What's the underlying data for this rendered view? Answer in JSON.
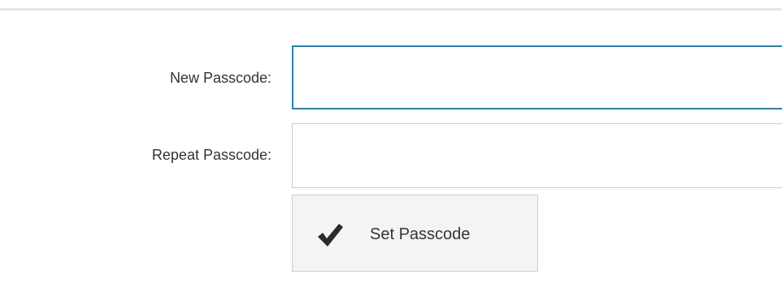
{
  "form": {
    "new_passcode_label": "New Passcode:",
    "new_passcode_value": "",
    "repeat_passcode_label": "Repeat Passcode:",
    "repeat_passcode_value": "",
    "submit_label": "Set Passcode",
    "submit_icon": "checkmark-icon"
  },
  "colors": {
    "focus_border": "#1b82c5",
    "default_border": "#cccccc",
    "button_background": "#f4f4f4",
    "text": "#333333"
  }
}
